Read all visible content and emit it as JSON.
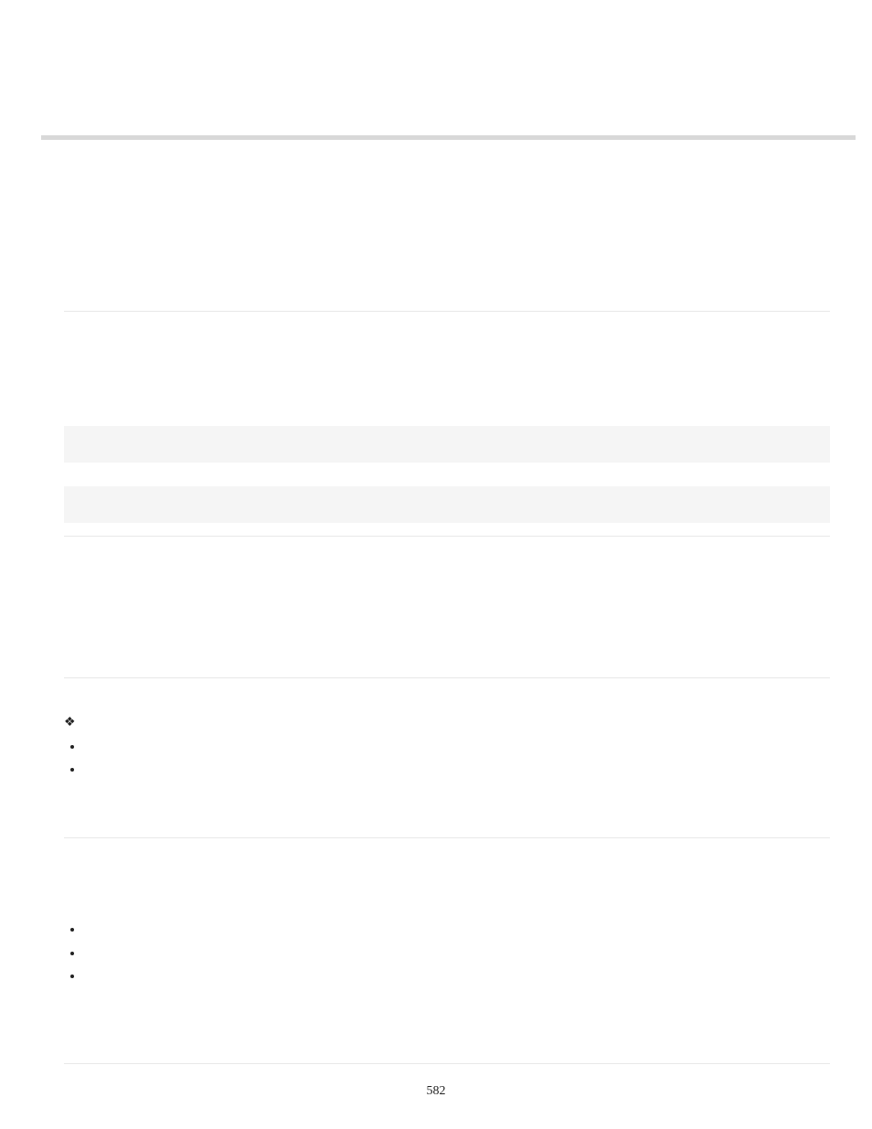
{
  "page_number": "582",
  "diamond_glyph": "❖"
}
